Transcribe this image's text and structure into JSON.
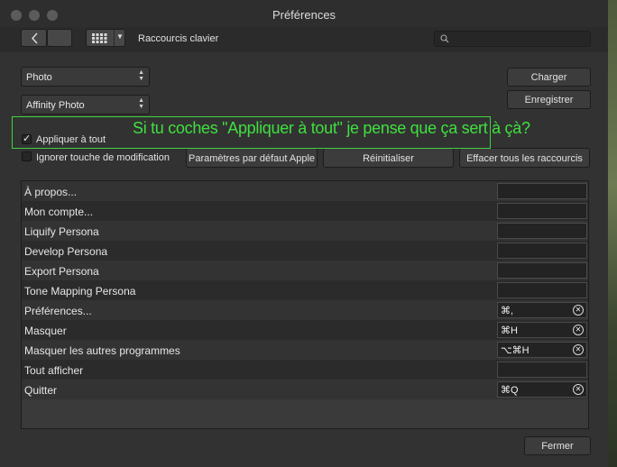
{
  "window": {
    "title": "Préférences"
  },
  "toolbar": {
    "back_icon": "chevron-left-icon",
    "grid_icon": "grid-icon",
    "section_title": "Raccourcis clavier",
    "search": {
      "placeholder": "",
      "icon": "magnifier-icon"
    }
  },
  "left_panel": {
    "app_dropdown": {
      "selected": "Photo"
    },
    "persona_dropdown": {
      "selected": "Affinity Photo"
    },
    "apply_all": {
      "label": "Appliquer à tout",
      "checked": true
    },
    "ignore_modifier": {
      "label": "Ignorer touche de modification",
      "checked": false
    }
  },
  "actions": {
    "load_label": "Charger",
    "save_label": "Enregistrer",
    "apple_defaults_label": "Paramètres par défaut Apple",
    "reset_label": "Réinitialiser",
    "clear_all_label": "Effacer tous les raccourcis"
  },
  "shortcuts": [
    {
      "name": "À propos...",
      "shortcut": ""
    },
    {
      "name": "Mon compte...",
      "shortcut": ""
    },
    {
      "name": "Liquify Persona",
      "shortcut": ""
    },
    {
      "name": "Develop Persona",
      "shortcut": ""
    },
    {
      "name": "Export Persona",
      "shortcut": ""
    },
    {
      "name": "Tone Mapping Persona",
      "shortcut": ""
    },
    {
      "name": "Préférences...",
      "shortcut": "⌘,"
    },
    {
      "name": "Masquer",
      "shortcut": "⌘H"
    },
    {
      "name": "Masquer les autres programmes",
      "shortcut": "⌥⌘H"
    },
    {
      "name": "Tout afficher",
      "shortcut": ""
    },
    {
      "name": "Quitter",
      "shortcut": "⌘Q"
    }
  ],
  "footer": {
    "close_label": "Fermer"
  },
  "annotation": {
    "text": "Si tu coches \"Appliquer à tout\" je pense que ça sert à çà?",
    "color": "#3fe03f"
  }
}
